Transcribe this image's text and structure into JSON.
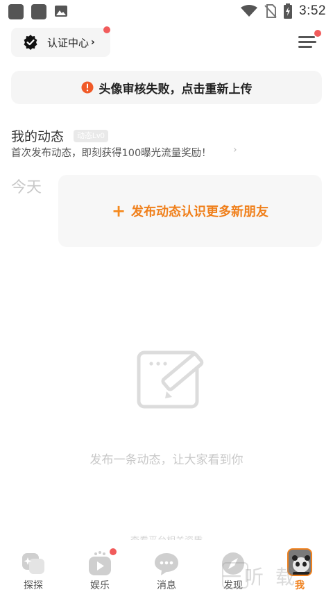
{
  "status_bar": {
    "time": "3:52",
    "icons": [
      "notification-square-icon",
      "notification-square-icon",
      "image-icon",
      "wifi-icon",
      "no-sim-icon",
      "battery-charging-icon"
    ]
  },
  "header": {
    "cert_label": "认证中心",
    "cert_arrow": "›",
    "cert_icon": "verified-badge-icon",
    "menu_icon": "menu-icon",
    "dot_color": "#f15b5b"
  },
  "notice": {
    "icon": "alert-circle-icon",
    "text": "头像审核失败，点击重新上传",
    "icon_color": "#f05a28"
  },
  "moments": {
    "title": "我的动态",
    "level_badge": "动态Lv0",
    "subtitle": "首次发布动态，即刻获得100曝光流量奖励！",
    "subtitle_arrow": "›"
  },
  "today": {
    "label": "今天",
    "post_prompt": "发布动态认识更多新朋友",
    "plus": "+",
    "accent": "#f0801c"
  },
  "empty_state": {
    "icon": "compose-note-icon",
    "text": "发布一条动态，让大家看到你"
  },
  "policy_text": "查看平台相关资质",
  "bottom_nav": {
    "items": [
      {
        "label": "探探",
        "icon": "tantan-icon"
      },
      {
        "label": "娱乐",
        "icon": "video-play-icon"
      },
      {
        "label": "消息",
        "icon": "chat-bubble-icon"
      },
      {
        "label": "发现",
        "icon": "compass-icon"
      },
      {
        "label": "我",
        "icon": "avatar-icon",
        "active": true
      }
    ]
  },
  "watermark": "一听 载"
}
